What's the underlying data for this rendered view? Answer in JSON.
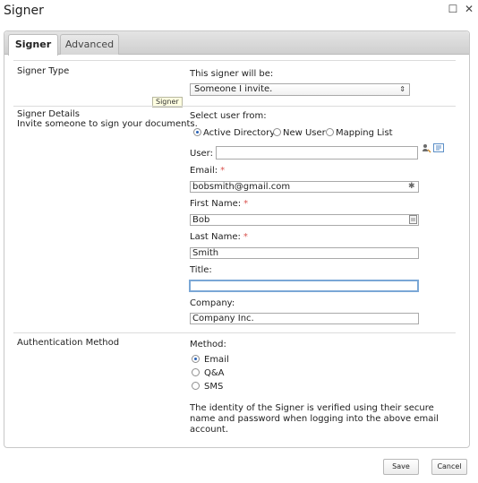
{
  "window": {
    "title": "Signer"
  },
  "tabs": [
    {
      "label": "Signer",
      "active": true
    },
    {
      "label": "Advanced",
      "active": false
    }
  ],
  "tooltip": "Signer",
  "signer_type": {
    "section_label": "Signer Type",
    "prompt": "This signer will be:",
    "selected": "Someone I invite."
  },
  "signer_details": {
    "section_label": "Signer Details",
    "section_desc": "Invite someone to sign your documents.",
    "select_user_label": "Select user from:",
    "options": [
      {
        "label": "Active Directory",
        "selected": true
      },
      {
        "label": "New User",
        "selected": false
      },
      {
        "label": "Mapping List",
        "selected": false
      }
    ],
    "user_label": "User:",
    "user_value": "",
    "email_label": "Email:",
    "email_value": "bobsmith@gmail.com",
    "first_name_label": "First Name:",
    "first_name_value": "Bob",
    "last_name_label": "Last Name:",
    "last_name_value": "Smith",
    "title_label": "Title:",
    "title_value": "",
    "company_label": "Company:",
    "company_value": "Company Inc.",
    "required_mark": "*"
  },
  "authentication": {
    "section_label": "Authentication Method",
    "method_label": "Method:",
    "options": [
      {
        "label": "Email",
        "selected": true
      },
      {
        "label": "Q&A",
        "selected": false
      },
      {
        "label": "SMS",
        "selected": false
      }
    ],
    "description": "The identity of the Signer is verified using their secure name and password when logging into the above email account."
  },
  "footer": {
    "save_label": "Save",
    "cancel_label": "Cancel"
  },
  "icons": {
    "maximize": "maximize-icon",
    "close": "close-icon",
    "address_book": "address-book-icon",
    "user_lookup": "user-lookup-icon",
    "password_key": "key-icon",
    "name_card": "contact-card-icon",
    "dropdown": "chevron-updown-icon"
  },
  "colors": {
    "focus_border": "#7aa7d6",
    "required": "#d9534f",
    "radio_selected": "#2a62b6"
  }
}
